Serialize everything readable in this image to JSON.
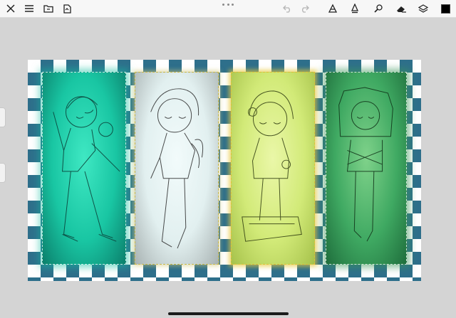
{
  "toolbar": {
    "left_buttons": [
      {
        "name": "close-icon"
      },
      {
        "name": "menu-icon"
      },
      {
        "name": "gallery-folder-icon"
      },
      {
        "name": "import-icon"
      }
    ],
    "more_options": "more-options-icon",
    "right_buttons": [
      {
        "name": "undo-icon"
      },
      {
        "name": "redo-icon"
      },
      {
        "name": "brush-library-icon"
      },
      {
        "name": "pen-tool-icon"
      },
      {
        "name": "smudge-icon"
      },
      {
        "name": "eraser-icon"
      },
      {
        "name": "layers-icon"
      },
      {
        "name": "color-swatch"
      }
    ],
    "active_color": "#000000"
  },
  "canvas": {
    "pattern_colors": [
      "#2e6f8b",
      "#ffffff"
    ],
    "panels": [
      {
        "name": "panel-teal",
        "color": "#19c6a3"
      },
      {
        "name": "panel-white",
        "color": "#e2f0f0"
      },
      {
        "name": "panel-yellow-green",
        "color": "#d2ea78"
      },
      {
        "name": "panel-green",
        "color": "#3fa962"
      }
    ]
  }
}
